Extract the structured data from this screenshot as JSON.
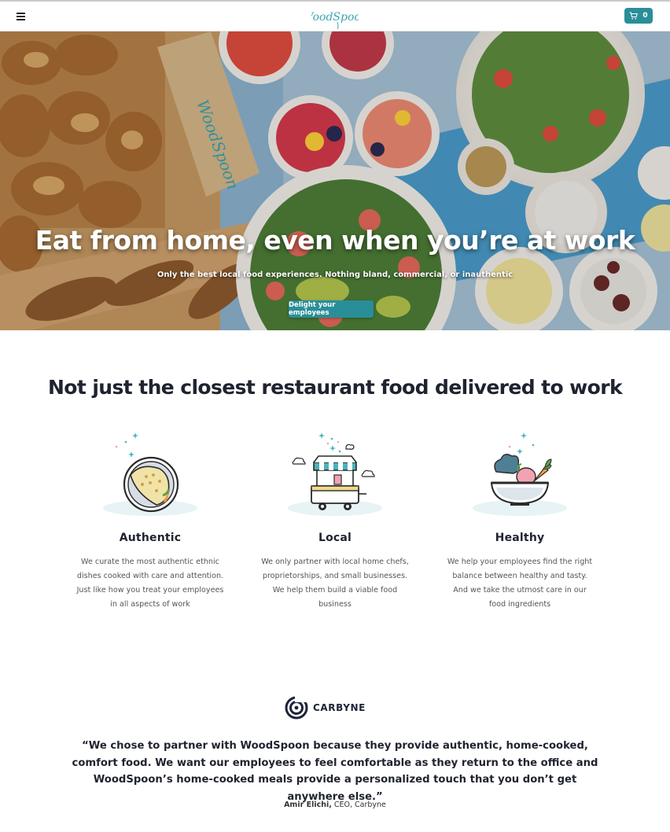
{
  "header": {
    "logo_text": "WoodSpoon",
    "cart_count": "0",
    "brand_color": "#2a8e98"
  },
  "hero": {
    "title": "Eat from home, even when you’re at work",
    "subtitle": "Only the best local food experiences. Nothing bland, commercial, or inauthentic",
    "cta_label": "Delight your employees",
    "box_logo_text": "WoodSpoon"
  },
  "features": {
    "title": "Not just the closest restaurant food delivered to work",
    "items": [
      {
        "icon": "taco-plate-icon",
        "heading": "Authentic",
        "text": "We curate the most authentic ethnic dishes cooked with care and attention. Just like how you treat your employees in all aspects of work"
      },
      {
        "icon": "food-cart-icon",
        "heading": "Local",
        "text": "We only partner with local home chefs, proprietorships, and small businesses. We help them build a viable food business"
      },
      {
        "icon": "salad-bowl-icon",
        "heading": "Healthy",
        "text": "We help your employees find the right balance between healthy and tasty. And we take the utmost care in our food ingredients"
      }
    ]
  },
  "testimonial": {
    "company": "CARBYNE",
    "quote": "“We chose to partner with WoodSpoon because they provide authentic, home-cooked, comfort food. We want our employees to feel comfortable as they return to the office and WoodSpoon’s home-cooked meals provide a personalized touch that you don’t get anywhere else.”",
    "author_name": "Amir Elichi,",
    "author_title": "CEO, Carbyne"
  }
}
